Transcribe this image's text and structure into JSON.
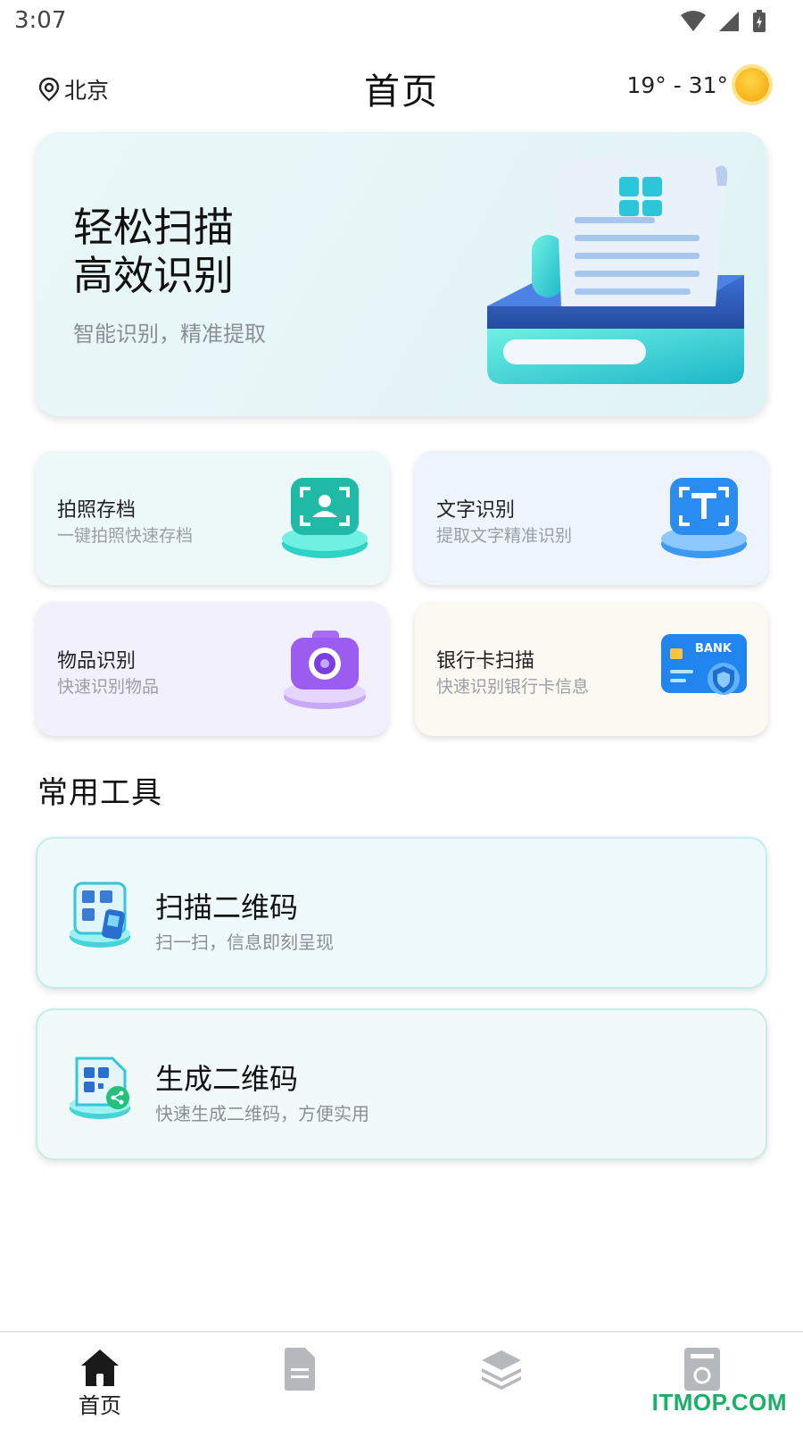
{
  "status_bar": {
    "time": "3:07"
  },
  "header": {
    "location": "北京",
    "title": "首页",
    "weather": "19° - 31°"
  },
  "hero": {
    "title": "轻松扫描\n高效识别",
    "subtitle": "智能识别，精准提取"
  },
  "features": [
    {
      "title": "拍照存档",
      "desc": "一键拍照快速存档",
      "icon": "camera-portrait-icon"
    },
    {
      "title": "文字识别",
      "desc": "提取文字精准识别",
      "icon": "text-scan-icon"
    },
    {
      "title": "物品识别",
      "desc": "快速识别物品",
      "icon": "camera-icon"
    },
    {
      "title": "银行卡扫描",
      "desc": "快速识别银行卡信息",
      "icon": "bank-card-icon",
      "card_text": "BANK"
    }
  ],
  "section": {
    "tools_title": "常用工具"
  },
  "tools": [
    {
      "title": "扫描二维码",
      "desc": "扫一扫，信息即刻呈现",
      "icon": "qr-scan-icon"
    },
    {
      "title": "生成二维码",
      "desc": "快速生成二维码，方便实用",
      "icon": "qr-generate-icon"
    }
  ],
  "bottom_nav": {
    "items": [
      {
        "label": "首页",
        "icon": "home-icon",
        "active": true
      },
      {
        "label": "",
        "icon": "document-icon",
        "active": false
      },
      {
        "label": "",
        "icon": "layers-icon",
        "active": false
      },
      {
        "label": "",
        "icon": "archive-icon",
        "active": false
      }
    ]
  },
  "watermark": "ITMOP.COM",
  "colors": {
    "accent_teal": "#2fd3c5",
    "accent_blue": "#2a8cf0",
    "accent_purple": "#9b5cf0",
    "nav_active": "#222222",
    "nav_inactive": "#b5b8bd"
  }
}
